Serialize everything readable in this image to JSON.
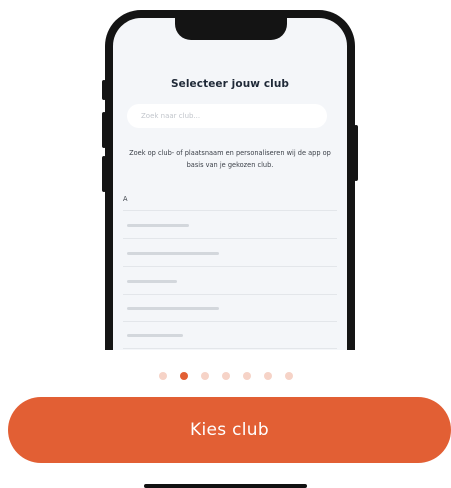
{
  "phone_screen": {
    "title": "Selecteer jouw club",
    "search": {
      "placeholder": "Zoek naar club..."
    },
    "description": "Zoek op club- of plaatsnaam en personaliseren wij de app op basis van je gekozen club.",
    "section_letter": "A"
  },
  "pagination": {
    "total": 7,
    "active_index": 1
  },
  "cta": {
    "label": "Kies club"
  },
  "colors": {
    "accent": "#e25f34",
    "dot_inactive": "#f6d3c7",
    "phone_frame": "#141414",
    "screen_bg": "#f4f6f9"
  }
}
